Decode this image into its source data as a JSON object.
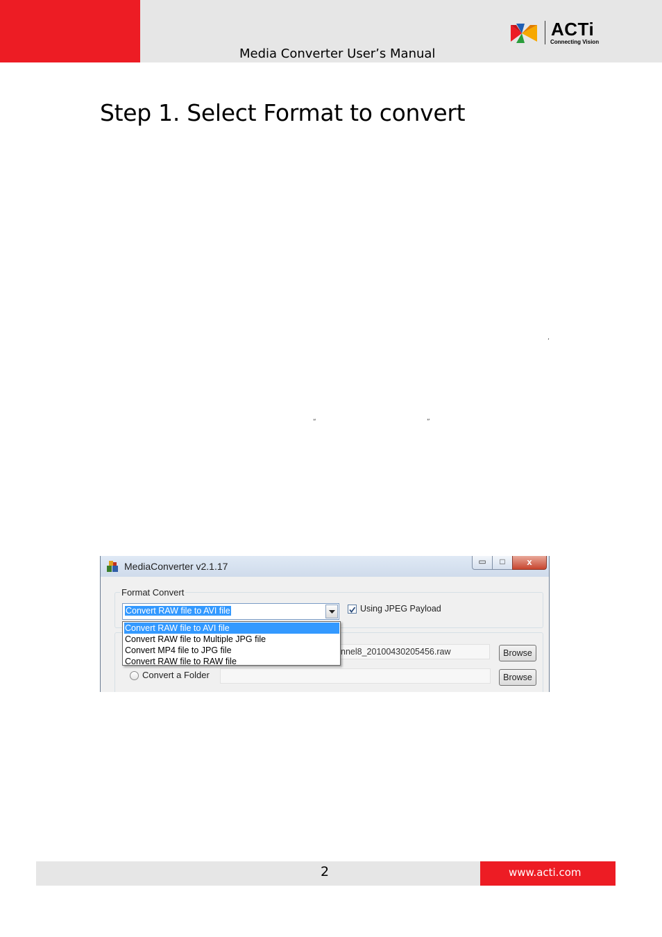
{
  "header": {
    "title": "Media Converter User’s Manual",
    "logo_word": "ACTi",
    "logo_tagline": "Connecting Vision"
  },
  "section": {
    "heading": "Step 1. Select Format to convert"
  },
  "marks": {
    "comma": "’",
    "open_quote": "“",
    "close_quote": "”"
  },
  "window": {
    "title": "MediaConverter v2.1.17",
    "close_symbol": "x",
    "format_group_label": "Format Convert",
    "selected_format": "Convert RAW file to AVI file",
    "jpeg_payload_label": "Using JPEG Payload",
    "jpeg_payload_checked": true,
    "dropdown_options": [
      "Convert RAW file to AVI file",
      "Convert RAW file to Multiple JPG file",
      "Convert MP4 file to JPG file",
      "Convert RAW file to RAW file"
    ],
    "file_path_visible": "nnel8_20100430205456.raw",
    "browse_label": "Browse",
    "browse_label_2": "Browse",
    "convert_folder_label": "Convert a Folder"
  },
  "footer": {
    "page_number": "2",
    "website": "www.acti.com"
  },
  "colors": {
    "brand_red": "#ed1c24",
    "band_gray": "#e6e6e6",
    "selection_blue": "#3399ff"
  }
}
